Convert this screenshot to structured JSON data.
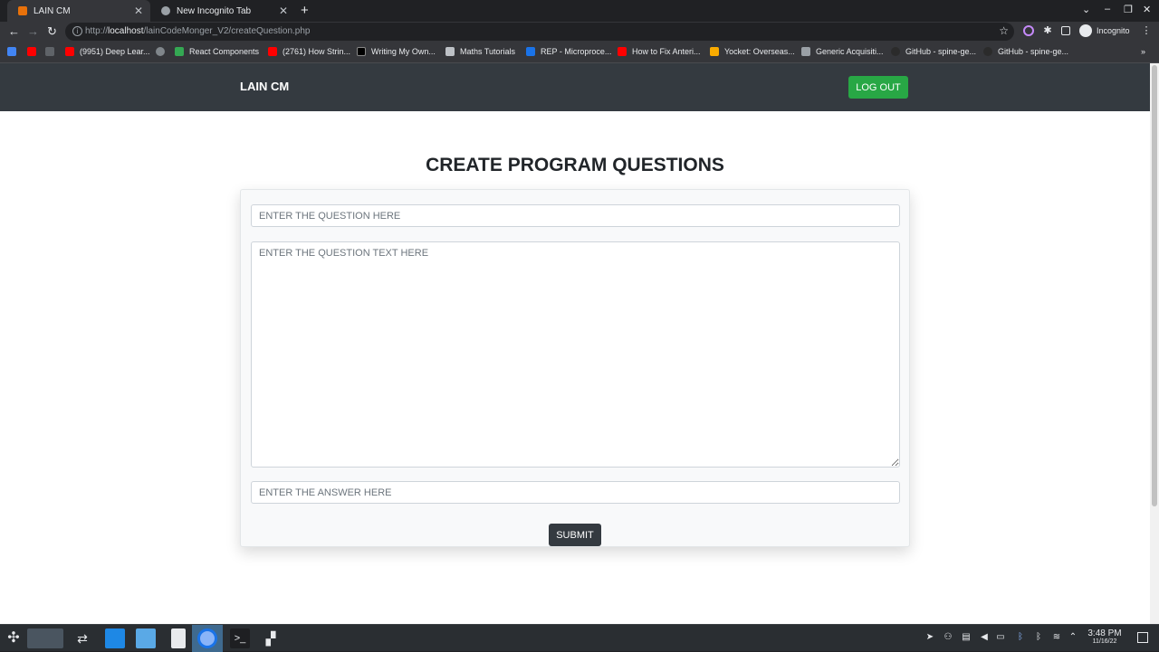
{
  "browser": {
    "tabs": [
      {
        "title": "LAIN CM",
        "active": true
      },
      {
        "title": "New Incognito Tab",
        "active": false
      }
    ],
    "url_prefix": "http://",
    "url_host": "localhost",
    "url_path": "/lainCodeMonger_V2/createQuestion.php",
    "profile_label": "Incognito",
    "bookmarks": [
      "(9951) Deep Lear...",
      "React Components",
      "(2761) How Strin...",
      "Writing My Own...",
      "Maths Tutorials",
      "REP - Microproce...",
      "How to Fix Anteri...",
      "Yocket: Overseas...",
      "Generic Acquisiti...",
      "GitHub - spine-ge...",
      "GitHub - spine-ge..."
    ]
  },
  "page": {
    "brand": "LAIN CM",
    "logout_label": "LOG OUT",
    "heading": "CREATE PROGRAM QUESTIONS",
    "question_placeholder": "ENTER THE QUESTION HERE",
    "question_text_placeholder": "ENTER THE QUESTION TEXT HERE",
    "answer_placeholder": "ENTER THE ANSWER HERE",
    "submit_label": "SUBMIT"
  },
  "taskbar": {
    "time": "3:48 PM",
    "date": "11/16/22"
  },
  "colors": {
    "navbar": "#343a40",
    "logout_button": "#28a745",
    "submit_button": "#343a40"
  }
}
